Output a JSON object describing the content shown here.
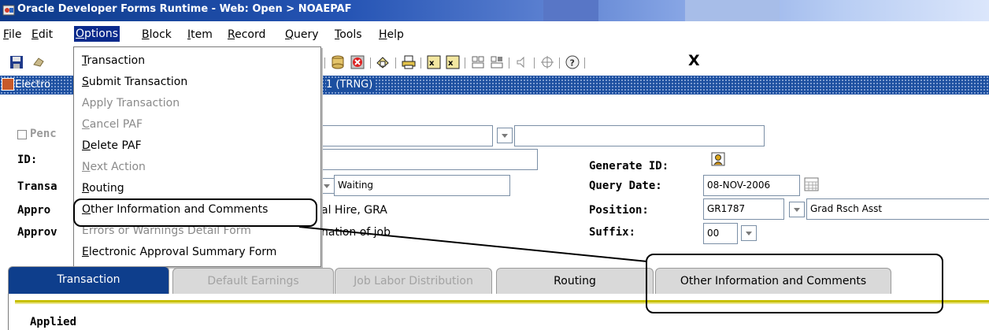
{
  "window": {
    "title": "Oracle Developer Forms Runtime - Web:  Open > NOAEPAF"
  },
  "menubar": {
    "items": [
      {
        "label": "File",
        "u": "F"
      },
      {
        "label": "Edit",
        "u": "E"
      },
      {
        "label": "Options",
        "u": "O",
        "active": true
      },
      {
        "label": "Block",
        "u": "B"
      },
      {
        "label": "Item",
        "u": "I"
      },
      {
        "label": "Record",
        "u": "R"
      },
      {
        "label": "Query",
        "u": "Q"
      },
      {
        "label": "Tools",
        "u": "T"
      },
      {
        "label": "Help",
        "u": "H"
      }
    ]
  },
  "toolbar": {
    "exit_label": "X"
  },
  "form_header": {
    "left_text": "Electro",
    "right_text": "1  (TRNG)"
  },
  "options_menu": {
    "items": [
      {
        "label": "Transaction",
        "enabled": true
      },
      {
        "label": "Submit Transaction",
        "enabled": true
      },
      {
        "label": "Apply Transaction",
        "enabled": false
      },
      {
        "label": "Cancel PAF",
        "enabled": false
      },
      {
        "label": "Delete PAF",
        "enabled": true
      },
      {
        "label": "Next Action",
        "enabled": false
      },
      {
        "label": "Routing",
        "enabled": true
      },
      {
        "label": "Other Information and Comments",
        "enabled": true,
        "highlighted": true
      },
      {
        "label": "Errors or Warnings Detail Form",
        "enabled": false
      },
      {
        "label": "Electronic Approval Summary Form",
        "enabled": true
      }
    ]
  },
  "form": {
    "pending_label": "Penc",
    "id_label": "ID:",
    "transaction_label": "Transa",
    "approval1_label": "Appro",
    "approval2_label": "Approv",
    "status_value": "Waiting",
    "approval_category_text": "al Hire, GRA",
    "approval_type_text": "nation of job",
    "generate_id_label": "Generate ID:",
    "query_date_label": "Query Date:",
    "query_date_value": "08-NOV-2006",
    "position_label": "Position:",
    "position_value": "GR1787",
    "position_title": "Grad Rsch Asst",
    "suffix_label": "Suffix:",
    "suffix_value": "00"
  },
  "tabs": [
    {
      "label": "Transaction",
      "state": "active"
    },
    {
      "label": "Default Earnings",
      "state": "disabled"
    },
    {
      "label": "Job Labor Distribution",
      "state": "disabled"
    },
    {
      "label": "Routing",
      "state": "normal"
    },
    {
      "label": "Other Information and Comments",
      "state": "normal"
    }
  ],
  "panel": {
    "applied_label": "Applied"
  },
  "colors": {
    "menu_highlight": "#0a2a8c",
    "form_header_blue": "#1c4fa0",
    "active_tab": "#0e3e8c",
    "tab_stripe": "#c8c000"
  }
}
